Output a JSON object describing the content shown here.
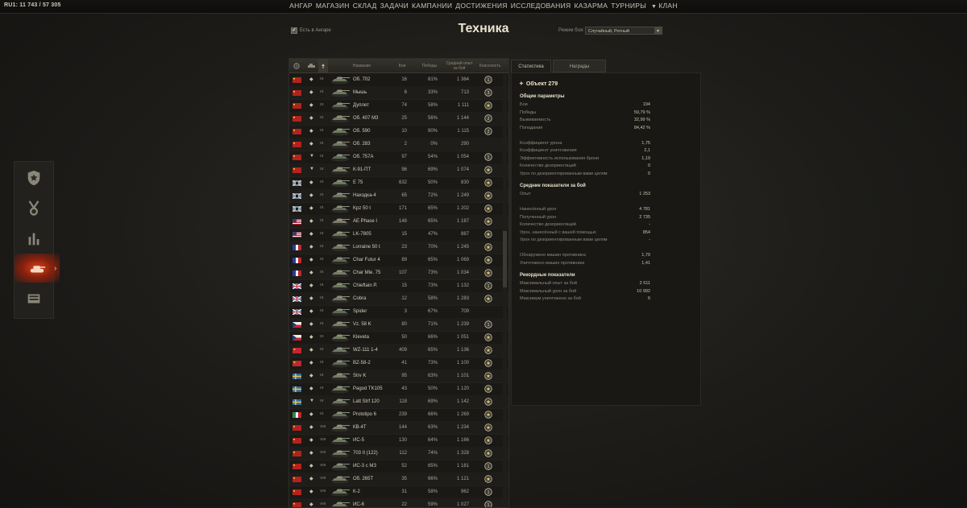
{
  "topbar": {
    "server": "RU1: 11 743 / 57 305",
    "nav": [
      {
        "label": "АНГАР",
        "active": false
      },
      {
        "label": "МАГАЗИН",
        "active": false
      },
      {
        "label": "СКЛАД",
        "active": false
      },
      {
        "label": "ЗАДАЧИ",
        "active": false
      },
      {
        "label": "КАМПАНИИ",
        "active": false
      },
      {
        "label": "ДОСТИЖЕНИЯ",
        "active": true
      },
      {
        "label": "ИССЛЕДОВАНИЯ",
        "active": false
      },
      {
        "label": "КАЗАРМА",
        "active": false
      },
      {
        "label": "ТУРНИРЫ",
        "active": false
      },
      {
        "label": "КЛАН",
        "active": false
      }
    ]
  },
  "sidebar": {
    "items": [
      {
        "icon": "summary-badge-icon"
      },
      {
        "icon": "medal-icon"
      },
      {
        "icon": "ratings-icon"
      },
      {
        "icon": "tank-icon",
        "active": true
      },
      {
        "icon": "awards-book-icon"
      }
    ]
  },
  "page": {
    "title": "Техника",
    "in_hangar_label": "Есть в Ангаре",
    "in_hangar_checked": "✔",
    "mode_label": "Режим боя:",
    "mode_value": "Случайный, Ротный"
  },
  "table": {
    "headers": {
      "name": "Название",
      "battles": "Бои",
      "wins": "Победы",
      "avg_xp": "Средний опыт за бой",
      "mastery": "Классность"
    },
    "rows": [
      {
        "nation": "ussr",
        "cls": "heavy",
        "tier": "IX",
        "name": "Об. 702",
        "battles": "16",
        "wins": "81%",
        "xp": "1 364",
        "mastery": "1"
      },
      {
        "nation": "ussr",
        "cls": "light",
        "tier": "IX",
        "name": "Мышь",
        "battles": "6",
        "wins": "33%",
        "xp": "713",
        "mastery": "3"
      },
      {
        "nation": "ussr",
        "cls": "heavy",
        "tier": "IX",
        "name": "Дуплет",
        "battles": "74",
        "wins": "58%",
        "xp": "1 111",
        "mastery": "ace"
      },
      {
        "nation": "ussr",
        "cls": "heavy",
        "tier": "IX",
        "name": "Об. 407 М3",
        "battles": "25",
        "wins": "56%",
        "xp": "1 144",
        "mastery": "2"
      },
      {
        "nation": "ussr",
        "cls": "heavy",
        "tier": "IX",
        "name": "Об. 590",
        "battles": "10",
        "wins": "90%",
        "xp": "1 115",
        "mastery": "2"
      },
      {
        "nation": "ussr",
        "cls": "heavy",
        "tier": "IX",
        "name": "Об. 283",
        "battles": "2",
        "wins": "0%",
        "xp": "290",
        "mastery": ""
      },
      {
        "nation": "ussr",
        "cls": "td",
        "tier": "IX",
        "name": "Об. 757А",
        "battles": "97",
        "wins": "54%",
        "xp": "1 054",
        "mastery": "1"
      },
      {
        "nation": "ussr",
        "cls": "td",
        "tier": "IX",
        "name": "К-91-ПТ",
        "battles": "96",
        "wins": "69%",
        "xp": "1 074",
        "mastery": "ace"
      },
      {
        "nation": "germany",
        "cls": "heavy",
        "tier": "IX",
        "name": "E 75",
        "battles": "632",
        "wins": "50%",
        "xp": "830",
        "mastery": "ace"
      },
      {
        "nation": "germany",
        "cls": "heavy",
        "tier": "IX",
        "name": "Находка-4",
        "battles": "65",
        "wins": "72%",
        "xp": "1 249",
        "mastery": "ace"
      },
      {
        "nation": "germany",
        "cls": "heavy",
        "tier": "IX",
        "name": "Kpz 50 t",
        "battles": "171",
        "wins": "65%",
        "xp": "1 202",
        "mastery": "ace"
      },
      {
        "nation": "usa",
        "cls": "heavy",
        "tier": "IX",
        "name": "AE Phase I",
        "battles": "148",
        "wins": "65%",
        "xp": "1 187",
        "mastery": "ace"
      },
      {
        "nation": "usa",
        "cls": "heavy",
        "tier": "IX",
        "name": "LK-7805",
        "battles": "15",
        "wins": "47%",
        "xp": "887",
        "mastery": "ace"
      },
      {
        "nation": "france",
        "cls": "heavy",
        "tier": "IX",
        "name": "Lorraine 50 t",
        "battles": "23",
        "wins": "70%",
        "xp": "1 245",
        "mastery": "ace"
      },
      {
        "nation": "france",
        "cls": "heavy",
        "tier": "IX",
        "name": "Char Futur 4",
        "battles": "89",
        "wins": "65%",
        "xp": "1 069",
        "mastery": "ace"
      },
      {
        "nation": "france",
        "cls": "heavy",
        "tier": "IX",
        "name": "Char Mle. 75",
        "battles": "107",
        "wins": "73%",
        "xp": "1 034",
        "mastery": "ace"
      },
      {
        "nation": "uk",
        "cls": "heavy",
        "tier": "IX",
        "name": "Chieftain P.",
        "battles": "15",
        "wins": "73%",
        "xp": "1 132",
        "mastery": "1"
      },
      {
        "nation": "uk",
        "cls": "heavy",
        "tier": "IX",
        "name": "Cobra",
        "battles": "12",
        "wins": "58%",
        "xp": "1 283",
        "mastery": "ace"
      },
      {
        "nation": "uk",
        "cls": "heavy",
        "tier": "IX",
        "name": "Spider",
        "battles": "3",
        "wins": "67%",
        "xp": "709",
        "mastery": ""
      },
      {
        "nation": "czech",
        "cls": "heavy",
        "tier": "IX",
        "name": "Vz. 58 K",
        "battles": "80",
        "wins": "71%",
        "xp": "1 239",
        "mastery": "1"
      },
      {
        "nation": "czech",
        "cls": "heavy",
        "tier": "IX",
        "name": "Kleveta",
        "battles": "50",
        "wins": "66%",
        "xp": "1 051",
        "mastery": "ace"
      },
      {
        "nation": "china",
        "cls": "heavy",
        "tier": "IX",
        "name": "WZ-111 1-4",
        "battles": "409",
        "wins": "65%",
        "xp": "1 136",
        "mastery": "ace"
      },
      {
        "nation": "china",
        "cls": "heavy",
        "tier": "IX",
        "name": "BZ-58-2",
        "battles": "41",
        "wins": "73%",
        "xp": "1 100",
        "mastery": "ace"
      },
      {
        "nation": "sweden",
        "cls": "heavy",
        "tier": "IX",
        "name": "Strv K",
        "battles": "95",
        "wins": "63%",
        "xp": "1 101",
        "mastery": "ace"
      },
      {
        "nation": "sweden",
        "cls": "heavy",
        "tier": "IX",
        "name": "Pagod TK105",
        "battles": "43",
        "wins": "50%",
        "xp": "1 120",
        "mastery": "ace"
      },
      {
        "nation": "sweden",
        "cls": "td",
        "tier": "IX",
        "name": "Latt Strf 120",
        "battles": "118",
        "wins": "69%",
        "xp": "1 142",
        "mastery": "ace"
      },
      {
        "nation": "italy",
        "cls": "heavy",
        "tier": "IX",
        "name": "Prototipo 6",
        "battles": "239",
        "wins": "66%",
        "xp": "1 269",
        "mastery": "ace"
      },
      {
        "nation": "ussr",
        "cls": "heavy",
        "tier": "VIII",
        "name": "КВ-4Т",
        "battles": "144",
        "wins": "63%",
        "xp": "1 234",
        "mastery": "ace"
      },
      {
        "nation": "ussr",
        "cls": "heavy",
        "tier": "VIII",
        "name": "ИС-5",
        "battles": "130",
        "wins": "64%",
        "xp": "1 166",
        "mastery": "ace"
      },
      {
        "nation": "ussr",
        "cls": "heavy",
        "tier": "VIII",
        "name": "703 II (122)",
        "battles": "112",
        "wins": "74%",
        "xp": "1 328",
        "mastery": "ace"
      },
      {
        "nation": "ussr",
        "cls": "heavy",
        "tier": "VIII",
        "name": "ИС-3 с МЗ",
        "battles": "52",
        "wins": "65%",
        "xp": "1 181",
        "mastery": "1"
      },
      {
        "nation": "ussr",
        "cls": "heavy",
        "tier": "VIII",
        "name": "Об. 265Т",
        "battles": "35",
        "wins": "66%",
        "xp": "1 121",
        "mastery": "ace"
      },
      {
        "nation": "ussr",
        "cls": "heavy",
        "tier": "VIII",
        "name": "К-2",
        "battles": "31",
        "wins": "58%",
        "xp": "962",
        "mastery": "1"
      },
      {
        "nation": "ussr",
        "cls": "heavy",
        "tier": "VIII",
        "name": "ИС-6",
        "battles": "22",
        "wins": "59%",
        "xp": "1 027",
        "mastery": "1"
      }
    ]
  },
  "tabs": [
    {
      "label": "Статистика",
      "active": true
    },
    {
      "label": "Награды",
      "active": false
    }
  ],
  "details": {
    "vehicle_name": "Объект 279",
    "sections": [
      {
        "title": "Общие параметры",
        "stats": [
          {
            "label": "Бои",
            "value": "194"
          },
          {
            "label": "Победы",
            "value": "59,79 %"
          },
          {
            "label": "Выживаемость",
            "value": "32,99 %"
          },
          {
            "label": "Попадания",
            "value": "84,42 %"
          },
          {
            "label": "",
            "value": ""
          },
          {
            "label": "Коэффициент урона",
            "value": "1,75"
          },
          {
            "label": "Коэффициент уничтожения",
            "value": "2,1"
          },
          {
            "label": "Эффективность использования брони",
            "value": "1,19"
          },
          {
            "label": "Количество дезориентаций",
            "value": "0"
          },
          {
            "label": "Урон по дезориентированным вами целям",
            "value": "0"
          }
        ]
      },
      {
        "title": "Средние показатели за бой",
        "stats": [
          {
            "label": "Опыт",
            "value": "1 253"
          },
          {
            "label": "",
            "value": ""
          },
          {
            "label": "Нанесённый урон",
            "value": "4 781"
          },
          {
            "label": "Полученный урон",
            "value": "2 735"
          },
          {
            "label": "Количество дезориентаций",
            "value": "-"
          },
          {
            "label": "Урон, нанесённый с вашей помощью",
            "value": "854"
          },
          {
            "label": "Урон по дезориентированным вами целям",
            "value": "-"
          },
          {
            "label": "",
            "value": ""
          },
          {
            "label": "Обнаружено машин противника",
            "value": "1,79"
          },
          {
            "label": "Уничтожено машин противника",
            "value": "1,41"
          }
        ]
      },
      {
        "title": "Рекордные показатели",
        "stats": [
          {
            "label": "Максимальный опыт за бой",
            "value": "2 511"
          },
          {
            "label": "Максимальный урон за бой",
            "value": "10 992"
          },
          {
            "label": "Максимум уничтожено за бой",
            "value": "6"
          }
        ]
      }
    ]
  },
  "colors": {
    "accent": "#f6a54a",
    "nav_text": "#c9c3ad",
    "sidebar_active": "#d8451c"
  }
}
